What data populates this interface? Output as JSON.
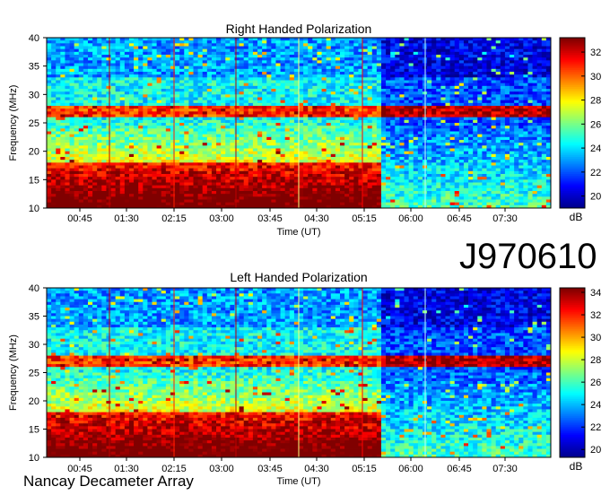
{
  "figure": {
    "label": "J970610",
    "credit": "Nancay Decameter Array"
  },
  "chart_data": [
    {
      "type": "heatmap",
      "title": "Right Handed Polarization",
      "xlabel": "Time (UT)",
      "ylabel": "Frequency (MHz)",
      "x_ticks": [
        "00:45",
        "01:30",
        "02:15",
        "03:00",
        "03:45",
        "04:30",
        "05:15",
        "06:00",
        "06:45",
        "07:30"
      ],
      "y_ticks": [
        10,
        15,
        20,
        25,
        30,
        35,
        40
      ],
      "ylim": [
        10,
        40
      ],
      "colorbar": {
        "label": "dB",
        "ticks": [
          20,
          22,
          24,
          26,
          28,
          30,
          32
        ],
        "range": [
          19,
          33.2
        ]
      },
      "colormap": [
        "#00008f",
        "#0000ff",
        "#007fff",
        "#00ffff",
        "#7fff7f",
        "#ffff00",
        "#ff7f00",
        "#ff0000",
        "#800000"
      ]
    },
    {
      "type": "heatmap",
      "title": "Left Handed Polarization",
      "xlabel": "Time (UT)",
      "ylabel": "Frequency (MHz)",
      "x_ticks": [
        "00:45",
        "01:30",
        "02:15",
        "03:00",
        "03:45",
        "04:30",
        "05:15",
        "06:00",
        "06:45",
        "07:30"
      ],
      "y_ticks": [
        10,
        15,
        20,
        25,
        30,
        35,
        40
      ],
      "ylim": [
        10,
        40
      ],
      "colorbar": {
        "label": "dB",
        "ticks": [
          20,
          22,
          24,
          26,
          28,
          30,
          32,
          34
        ],
        "range": [
          19.3,
          34.4
        ]
      },
      "colormap": [
        "#00008f",
        "#0000ff",
        "#007fff",
        "#00ffff",
        "#7fff7f",
        "#ffff00",
        "#ff7f00",
        "#ff0000",
        "#800000"
      ]
    }
  ]
}
